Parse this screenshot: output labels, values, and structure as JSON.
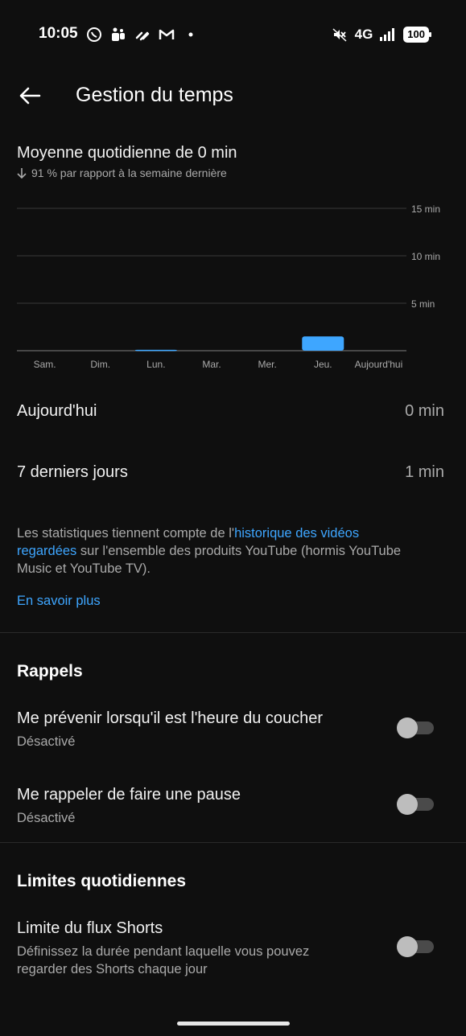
{
  "status_bar": {
    "time": "10:05",
    "network": "4G",
    "battery": "100",
    "left_icons": [
      "whatsapp-icon",
      "teams-icon",
      "app-icon",
      "gmail-icon",
      "dot-icon"
    ],
    "right_icons": [
      "mute-icon",
      "signal-icon"
    ]
  },
  "header": {
    "title": "Gestion du temps"
  },
  "summary": {
    "title": "Moyenne quotidienne de 0 min",
    "change": "91 % par rapport à la semaine dernière"
  },
  "chart_data": {
    "type": "bar",
    "categories": [
      "Sam.",
      "Dim.",
      "Lun.",
      "Mar.",
      "Mer.",
      "Jeu.",
      "Aujourd'hui"
    ],
    "values": [
      0,
      0,
      0.1,
      0,
      0,
      1.5,
      0
    ],
    "y_tick_labels": [
      "5 min",
      "10 min",
      "15 min"
    ],
    "ylim": [
      0,
      15
    ],
    "ylabel": "",
    "xlabel": "",
    "bar_color": "#3ea6ff",
    "grid": true
  },
  "stats": {
    "today_label": "Aujourd'hui",
    "today_value": "0 min",
    "week_label": "7 derniers jours",
    "week_value": "1 min"
  },
  "info": {
    "text_before": "Les statistiques tiennent compte de l'",
    "link": "historique des vidéos regardées",
    "text_after": " sur l'ensemble des produits YouTube (hormis YouTube Music et YouTube TV).",
    "learn_more": "En savoir plus"
  },
  "reminders": {
    "title": "Rappels",
    "bedtime_title": "Me prévenir lorsqu'il est l'heure du coucher",
    "bedtime_status": "Désactivé",
    "break_title": "Me rappeler de faire une pause",
    "break_status": "Désactivé"
  },
  "limits": {
    "title": "Limites quotidiennes",
    "shorts_title": "Limite du flux Shorts",
    "shorts_desc": "Définissez la durée pendant laquelle vous pouvez regarder des Shorts chaque jour"
  },
  "colors": {
    "background": "#0f0f0f",
    "accent": "#3ea6ff",
    "secondary_text": "#aaaaaa"
  }
}
